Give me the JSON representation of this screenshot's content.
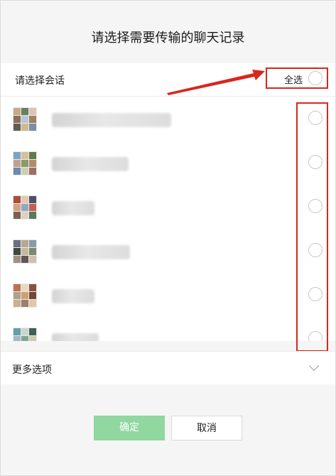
{
  "dialog": {
    "title": "请选择需要传输的聊天记录",
    "header_label": "请选择会话",
    "select_all_label": "全选",
    "more_options_label": "更多选项",
    "confirm_label": "确定",
    "cancel_label": "取消"
  },
  "colors": {
    "annotation_red": "#d9261c",
    "confirm_disabled_green": "#90d7a0"
  },
  "conversations": [
    {
      "avatar_colors": [
        "#c9a88a",
        "#6b7f5a",
        "#d8c7b5",
        "#8c6e5a",
        "#b5c7d6",
        "#a07f63",
        "#5e5e4e",
        "#d0b88f",
        "#7c8ea0"
      ]
    },
    {
      "avatar_colors": [
        "#7aa5c9",
        "#d7c09a",
        "#5f7d4c",
        "#c2a28e",
        "#8a9a6a",
        "#b58a6a",
        "#6a8ab0",
        "#d0d0b0",
        "#9c7060"
      ]
    },
    {
      "avatar_colors": [
        "#b04a3a",
        "#e2c9b0",
        "#4f4f6a",
        "#d8a080",
        "#90a8c0",
        "#c06050",
        "#7a6050",
        "#e0d0c0",
        "#5a7a5a"
      ]
    },
    {
      "avatar_colors": [
        "#6a7080",
        "#b8a890",
        "#8a9aa8",
        "#3e4a40",
        "#c8b8a0",
        "#7a8a70",
        "#a09080",
        "#605850",
        "#d0c0b0"
      ]
    },
    {
      "avatar_colors": [
        "#c07050",
        "#e8d8c0",
        "#8a5040",
        "#b0a090",
        "#d0a070",
        "#704838",
        "#c8b090",
        "#9a8070",
        "#e0c8a8"
      ]
    },
    {
      "avatar_colors": [
        "#60a0a8",
        "#c8d8d0",
        "#406050",
        "#a8b8c0",
        "#80a890",
        "#d0c8b0",
        "#507080",
        "#b0c0b8",
        "#708878"
      ]
    }
  ]
}
